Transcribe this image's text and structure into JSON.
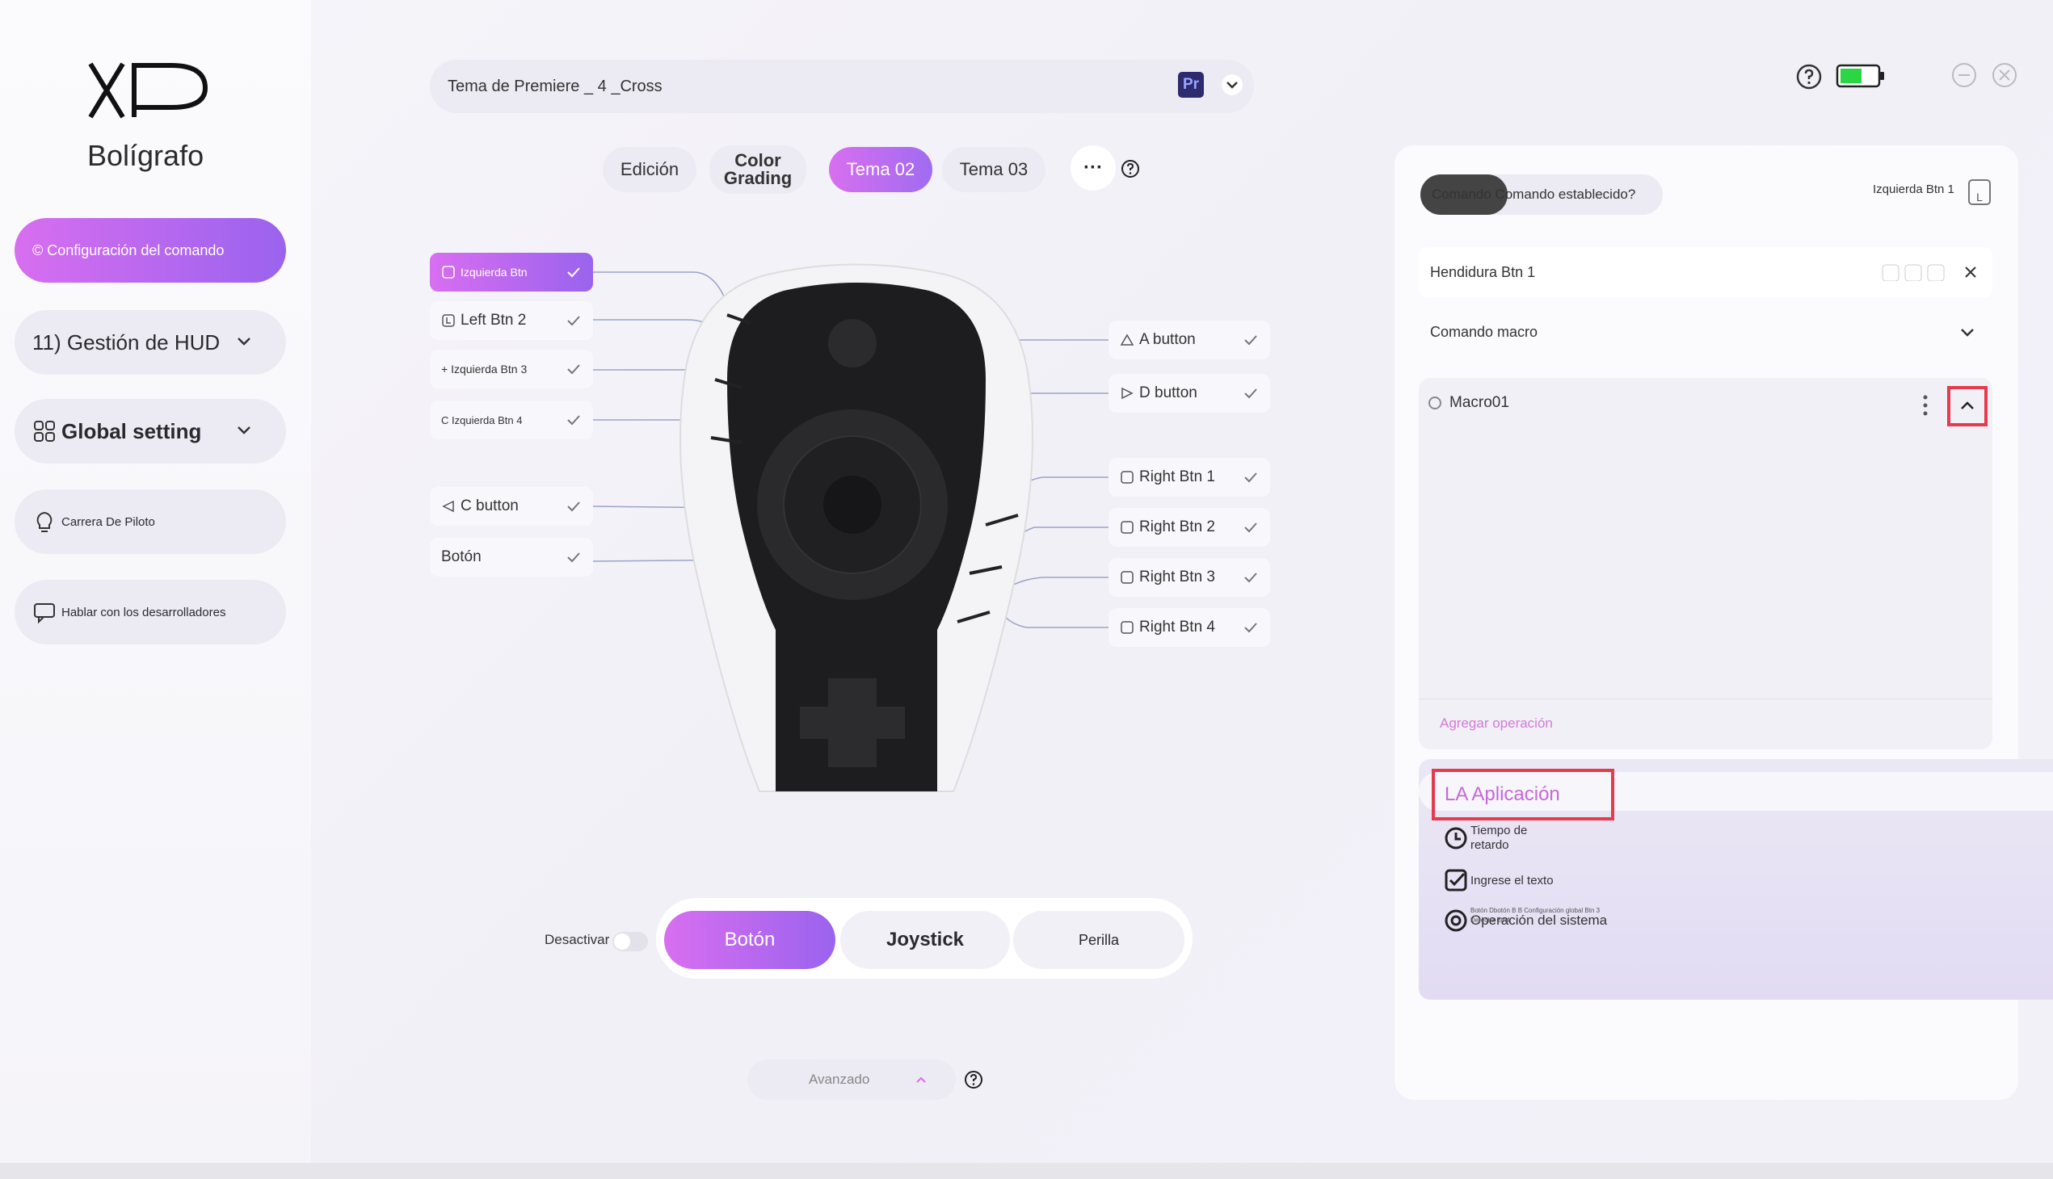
{
  "app": {
    "product_name": "Bolígrafo",
    "profile_selector": "Tema de Premiere _ 4 _Cross",
    "profile_app_icon": "Pr"
  },
  "sidebar": {
    "items": [
      {
        "label": "© Configuración del comando",
        "active": true
      },
      {
        "label": "11) Gestión de HUD"
      },
      {
        "label": "Global setting"
      },
      {
        "label": "Carrera De Piloto"
      },
      {
        "label": "Hablar con los desarrolladores"
      }
    ]
  },
  "tabs": [
    {
      "label": "Edición"
    },
    {
      "label": "Color Grading"
    },
    {
      "label": "Tema 02",
      "active": true
    },
    {
      "label": "Tema 03"
    }
  ],
  "more_label": "···",
  "buttons_left": [
    {
      "label": "Izquierda Btn",
      "active": true
    },
    {
      "label": "Left Btn 2"
    },
    {
      "label": "+ Izquierda Btn 3"
    },
    {
      "label": "C Izquierda Btn 4"
    },
    {
      "label": "C button"
    },
    {
      "label": "Botón"
    }
  ],
  "buttons_right": [
    {
      "label": "A button"
    },
    {
      "label": "D button"
    },
    {
      "label": "Right Btn 1"
    },
    {
      "label": "Right Btn 2"
    },
    {
      "label": "Right Btn 3"
    },
    {
      "label": "Right Btn 4"
    }
  ],
  "bottom": {
    "deactivate_label": "Desactivar",
    "modes": [
      "Botón",
      "Joystick",
      "Perilla"
    ],
    "active_mode": "Botón",
    "advanced_label": "Avanzado"
  },
  "panel": {
    "command_set_label": "Comando Comando establecido?",
    "command_key": "Izquierda Btn 1",
    "command_key_icon": "L",
    "key_field": "Hendidura Btn 1",
    "command_type": "Comando macro",
    "macro_name": "Macro01",
    "add_operation": "Agregar operación",
    "application_title": "LA Aplicación",
    "menu": [
      {
        "label": "Tiempo de retardo",
        "icon": "clock-icon"
      },
      {
        "label": "Ingrese el texto",
        "icon": "checkbox-icon"
      },
      {
        "label": "Operación del sistema",
        "icon": "target-icon",
        "note": "Botón Dbotón B B Configuración global Btn 3 Derecha Btn4"
      }
    ]
  },
  "colors": {
    "accent_start": "#d86ef0",
    "accent_end": "#9a63ee",
    "highlight_box": "#e53b4d",
    "battery_green": "#2bd645"
  }
}
